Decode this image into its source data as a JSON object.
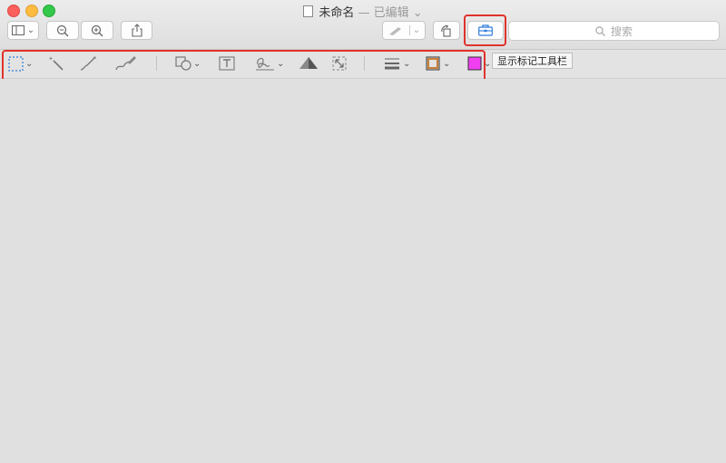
{
  "window": {
    "title": "未命名",
    "title_suffix": "— 已编辑",
    "title_chevron": "⌄"
  },
  "toolbar": {
    "sidebar_chevron": "⌄",
    "annotate_chevron": "⌄",
    "search_placeholder": "搜索"
  },
  "markup": {
    "tooltip": "显示标记工具栏",
    "chevron": "⌄",
    "border_color": "#c77f3a",
    "fill_color": "#ef3ff0"
  },
  "colors": {
    "highlight": "#e0332b",
    "toolbox_icon": "#2f7ddb"
  }
}
